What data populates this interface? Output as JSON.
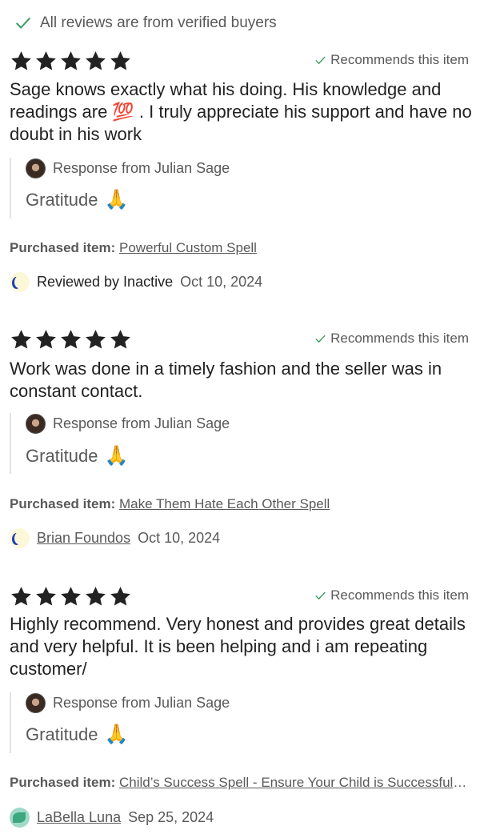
{
  "banner": {
    "text": "All reviews are from verified buyers",
    "icon": "check-icon"
  },
  "colors": {
    "star": "#222222",
    "check": "#3c9a5f",
    "muted": "#595959",
    "text": "#222222",
    "rule": "#e3e3e3"
  },
  "reviews": [
    {
      "rating": 5,
      "recommends": "Recommends this item",
      "text": "Sage knows exactly what his doing. His knowledge and readings are 💯 . I truly appreciate his support and have no doubt in his work",
      "response": {
        "from": "Response from Julian Sage",
        "body": "Gratitude",
        "emoji": "🙏"
      },
      "purchased_label": "Purchased item:",
      "purchased_item": "Powerful Custom Spell",
      "reviewer": "Reviewed by Inactive",
      "date": "Oct 10, 2024"
    },
    {
      "rating": 5,
      "recommends": "Recommends this item",
      "text": "Work was done in a timely fashion and the seller was in constant contact.",
      "response": {
        "from": "Response from Julian Sage",
        "body": "Gratitude",
        "emoji": "🙏"
      },
      "purchased_label": "Purchased item:",
      "purchased_item": "Make Them Hate Each Other Spell",
      "reviewer": "Brian Foundos",
      "date": "Oct 10, 2024"
    },
    {
      "rating": 5,
      "recommends": "Recommends this item",
      "text": "Highly recommend. Very honest and provides great details and very helpful. It is been helping and i am repeating customer/",
      "response": {
        "from": "Response from Julian Sage",
        "body": "Gratitude",
        "emoji": "🙏"
      },
      "purchased_label": "Purchased item:",
      "purchased_item": "Child’s Success Spell - Ensure Your Child is Successful in Life",
      "reviewer": "LaBella Luna",
      "date": "Sep 25, 2024"
    }
  ]
}
